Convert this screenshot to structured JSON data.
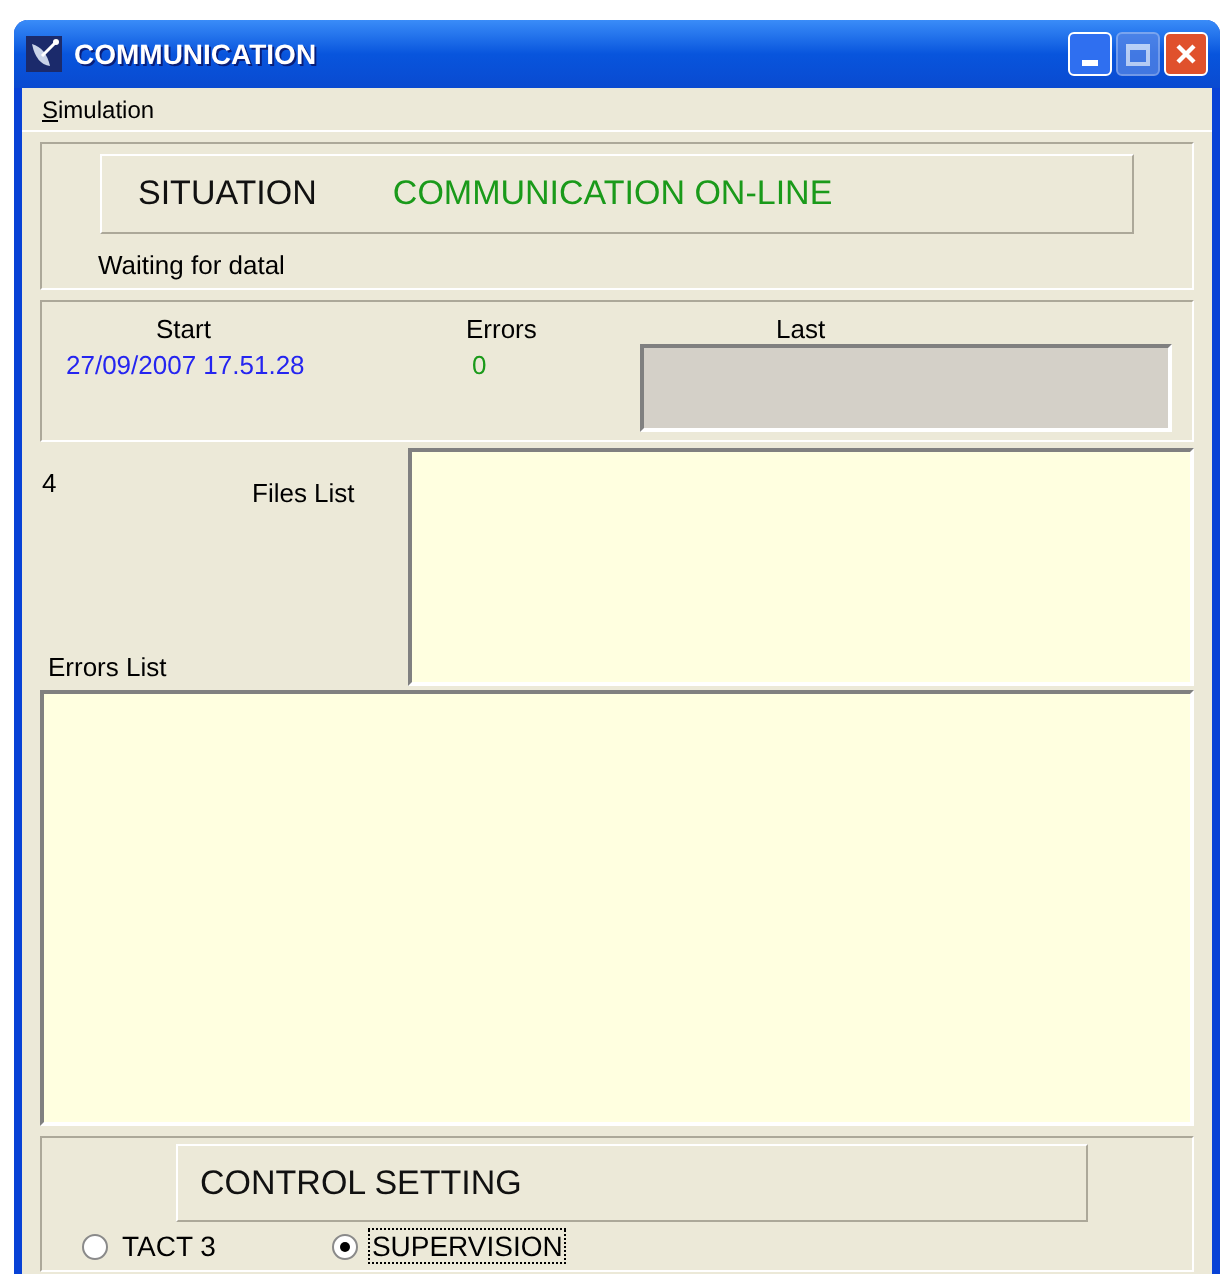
{
  "window": {
    "title": "COMMUNICATION"
  },
  "menu": [
    {
      "label": "Simulation"
    }
  ],
  "situation": {
    "label": "SITUATION",
    "status": "COMMUNICATION ON-LINE",
    "message": "Waiting for datal"
  },
  "stats": {
    "start_label": "Start",
    "start_value": "27/09/2007 17.51.28",
    "errors_label": "Errors",
    "errors_value": "0",
    "last_label": "Last"
  },
  "files": {
    "count": "4",
    "files_label": "Files List",
    "errors_label": "Errors List"
  },
  "control": {
    "title": "CONTROL SETTING",
    "options": [
      {
        "label": "TACT 3",
        "selected": false
      },
      {
        "label": "SUPERVISION",
        "selected": true
      }
    ]
  }
}
